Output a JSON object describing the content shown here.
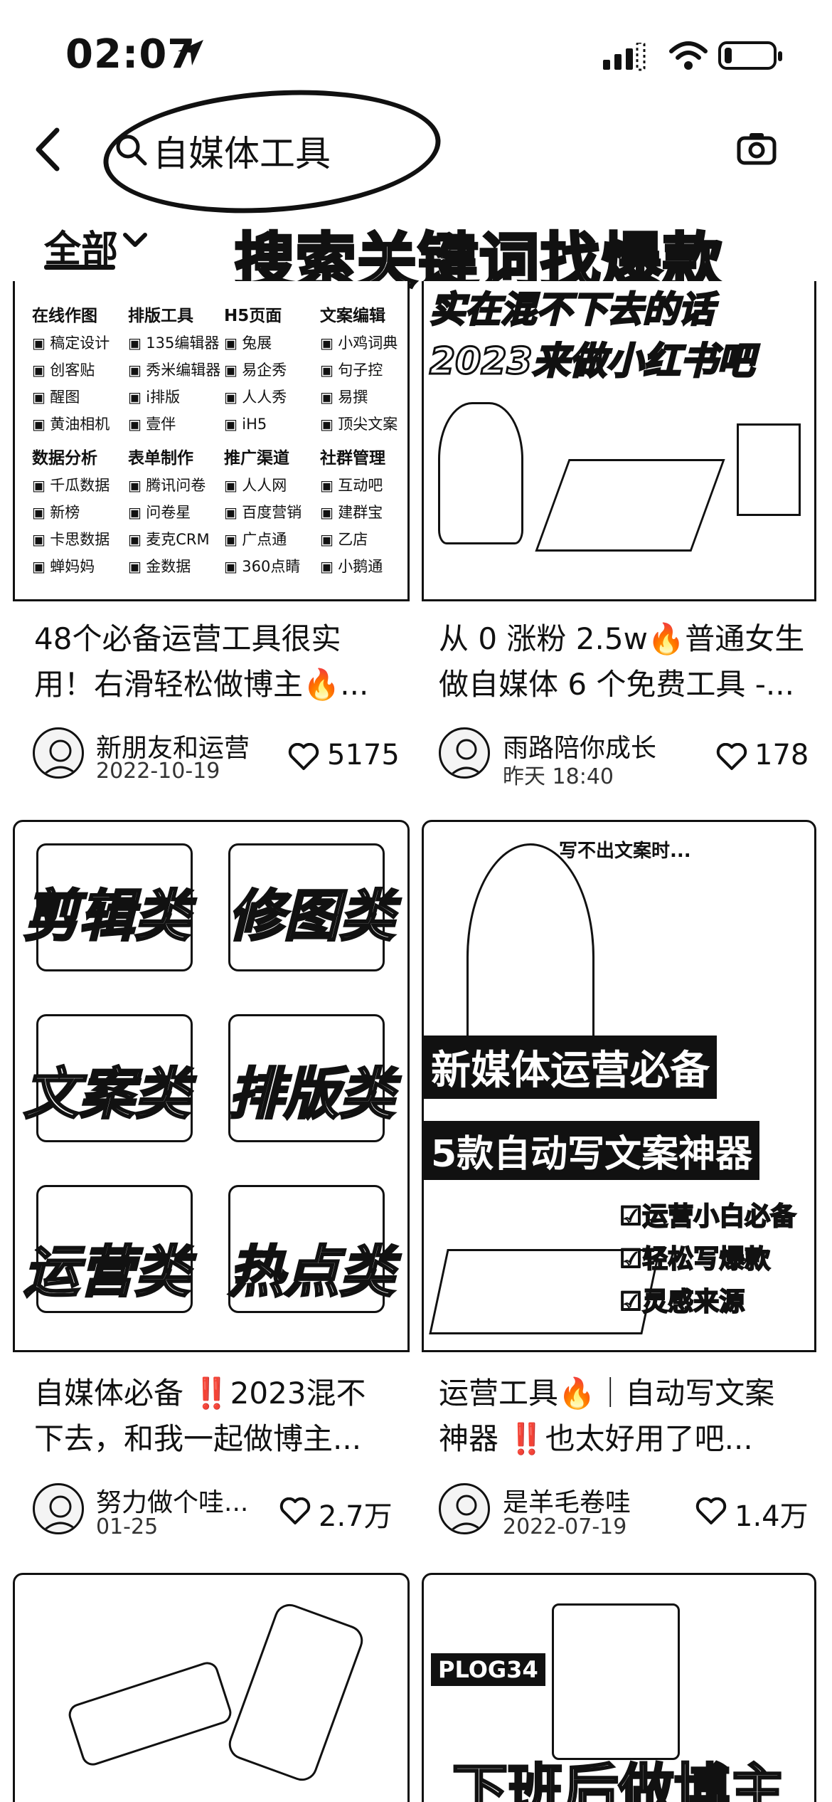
{
  "status_bar": {
    "time": "02:07",
    "battery_level": 0.15
  },
  "search": {
    "query": "自媒体工具"
  },
  "filter": {
    "tab_label": "全部",
    "overlay_caption": "搜索关键词找爆款"
  },
  "cards": [
    {
      "title_line1": "48个必备运营工具很实",
      "title_line2": "用！右滑轻松做博主🔥...",
      "author": "新朋友和运营",
      "date": "2022-10-19",
      "likes": "5175",
      "thumb": {
        "columns": [
          {
            "header": "在线作图",
            "items": [
              "稿定设计",
              "创客贴",
              "醒图",
              "黄油相机"
            ]
          },
          {
            "header": "排版工具",
            "items": [
              "135编辑器",
              "秀米编辑器",
              "i排版",
              "壹伴"
            ]
          },
          {
            "header": "H5页面",
            "items": [
              "兔展",
              "易企秀",
              "人人秀",
              "iH5"
            ]
          },
          {
            "header": "文案编辑",
            "items": [
              "小鸡词典",
              "句子控",
              "易撰",
              "顶尖文案"
            ]
          },
          {
            "header": "数据分析",
            "items": [
              "千瓜数据",
              "新榜",
              "卡思数据",
              "蝉妈妈"
            ]
          },
          {
            "header": "表单制作",
            "items": [
              "腾讯问卷",
              "问卷星",
              "麦克CRM",
              "金数据"
            ]
          },
          {
            "header": "推广渠道",
            "items": [
              "人人网",
              "百度营销",
              "广点通",
              "360点睛"
            ]
          },
          {
            "header": "社群管理",
            "items": [
              "互动吧",
              "建群宝",
              "乙店",
              "小鹅通"
            ]
          }
        ]
      }
    },
    {
      "title_line1": "从 0 涨粉 2.5w🔥普通女生",
      "title_line2": "做自媒体 6 个免费工具 -...",
      "author": "雨路陪你成长",
      "date": "昨天 18:40",
      "likes": "178",
      "thumb": {
        "line1": "实在混不下去的话",
        "line2": "2023来做小红书吧"
      }
    },
    {
      "title_line1": "自媒体必备 ‼️2023混不",
      "title_line2": "下去，和我一起做博主...",
      "author": "努力做个哇...",
      "date": "01-25",
      "likes": "2.7万",
      "thumb": {
        "words": [
          "剪辑类",
          "修图类",
          "文案类",
          "排版类",
          "运营类",
          "热点类"
        ]
      }
    },
    {
      "title_line1": "运营工具🔥｜自动写文案",
      "title_line2": "神器 ‼️也太好用了吧...",
      "author": "是羊毛卷哇",
      "date": "2022-07-19",
      "likes": "1.4万",
      "thumb": {
        "top_note": "写不出文案时...",
        "banner1": "新媒体运营必备",
        "banner2": "5款自动写文案神器",
        "checks": [
          "☑运营小白必备",
          "☑轻松写爆款",
          "☑灵感来源"
        ]
      }
    },
    {
      "thumb": {
        "caption": ""
      }
    },
    {
      "thumb": {
        "tag": "PLOG34",
        "caption": "下班后做博主"
      }
    }
  ]
}
